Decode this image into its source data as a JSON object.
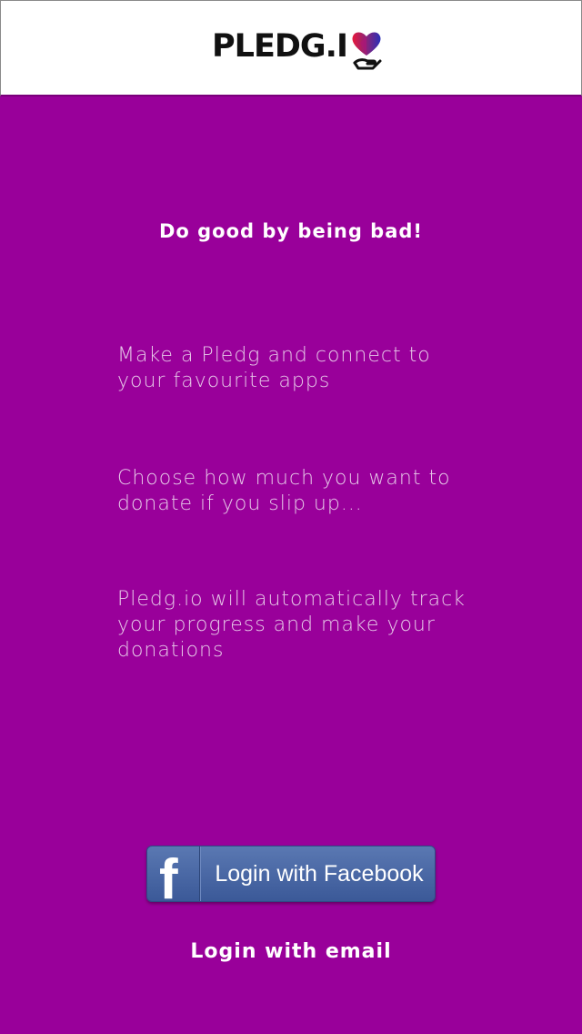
{
  "header": {
    "logo_text": "PLEDG.I",
    "logo_icon": "heart-hand-icon"
  },
  "tagline": "Do good by being bad!",
  "steps": [
    "Make a Pledg and connect to your favourite apps",
    "Choose how much you want to donate if you slip up...",
    "Pledg.io will automatically track your progress and make your donations"
  ],
  "facebook": {
    "icon": "facebook-f-icon",
    "icon_glyph": "f",
    "label": "Login with Facebook"
  },
  "email_login": "Login with email",
  "colors": {
    "background": "#99009a",
    "header_bg": "#ffffff",
    "facebook_blue": "#3b5998"
  }
}
